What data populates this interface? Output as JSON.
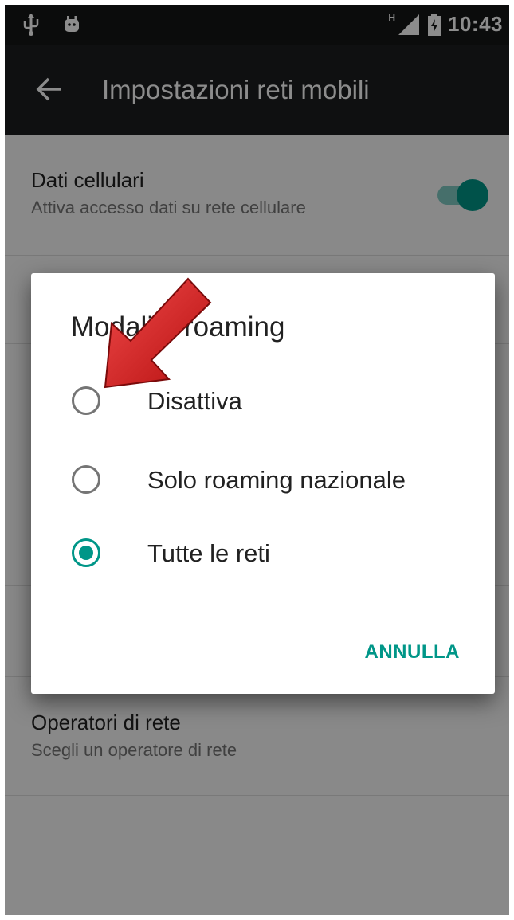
{
  "status_bar": {
    "network_type": "H",
    "time": "10:43",
    "icons": [
      "usb-icon",
      "android-icon",
      "signal-icon",
      "battery-icon"
    ]
  },
  "app_bar": {
    "title": "Impostazioni reti mobili",
    "back_icon": "arrow-left-icon"
  },
  "settings": {
    "items": [
      {
        "title": "Dati cellulari",
        "subtitle": "Attiva accesso dati su rete cellulare",
        "toggle_on": true
      },
      {
        "title": "Operatori di rete",
        "subtitle": "Scegli un operatore di rete"
      }
    ]
  },
  "dialog": {
    "title": "Modalità roaming",
    "options": [
      {
        "label": "Disattiva",
        "selected": false
      },
      {
        "label": "Solo roaming nazionale",
        "selected": false
      },
      {
        "label": "Tutte le reti",
        "selected": true
      }
    ],
    "cancel_label": "ANNULLA"
  },
  "colors": {
    "accent": "#009688",
    "toolbar": "#1c1e1f",
    "status_bar": "#141616",
    "annotation_arrow": "#d81b1b"
  }
}
